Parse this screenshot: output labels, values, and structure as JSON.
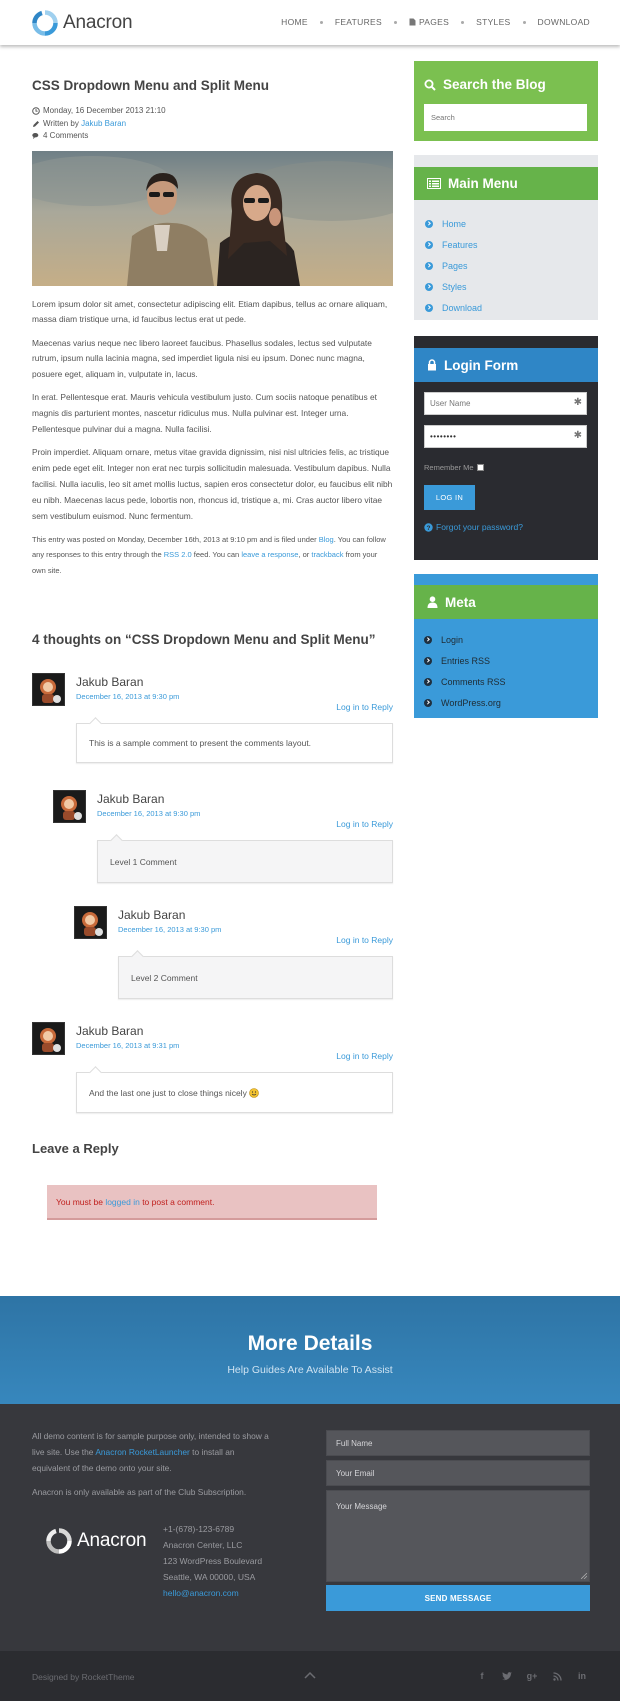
{
  "header": {
    "brand": "Anacron",
    "nav": [
      "HOME",
      "FEATURES",
      "PAGES",
      "STYLES",
      "DOWNLOAD"
    ]
  },
  "post": {
    "title": "CSS Dropdown Menu and Split Menu",
    "date": "Monday, 16 December 2013 21:10",
    "written_by_label": "Written by",
    "author": "Jakub Baran",
    "comments_count": "4 Comments",
    "paragraphs": [
      "Lorem ipsum dolor sit amet, consectetur adipiscing elit. Etiam dapibus, tellus ac ornare aliquam, massa diam tristique urna, id faucibus lectus erat ut pede.",
      "Maecenas varius neque nec libero laoreet faucibus. Phasellus sodales, lectus sed vulputate rutrum, ipsum nulla lacinia magna, sed imperdiet ligula nisi eu ipsum. Donec nunc magna, posuere eget, aliquam in, vulputate in, lacus.",
      "In erat. Pellentesque erat. Mauris vehicula vestibulum justo. Cum sociis natoque penatibus et magnis dis parturient montes, nascetur ridiculus mus. Nulla pulvinar est. Integer urna. Pellentesque pulvinar dui a magna. Nulla facilisi.",
      "Proin imperdiet. Aliquam ornare, metus vitae gravida dignissim, nisi nisl ultricies felis, ac tristique enim pede eget elit. Integer non erat nec turpis sollicitudin malesuada. Vestibulum dapibus. Nulla facilisi. Nulla iaculis, leo sit amet mollis luctus, sapien eros consectetur dolor, eu faucibus elit nibh eu nibh. Maecenas lacus pede, lobortis non, rhoncus id, tristique a, mi. Cras auctor libero vitae sem vestibulum euismod. Nunc fermentum."
    ],
    "footnote": {
      "p1": "This entry was posted on Monday, December 16th, 2013 at 9:10 pm and is filed under ",
      "category": "Blog",
      "p2": ". You can follow any responses to this entry through the ",
      "rss": "RSS 2.0",
      "p3": " feed. You can ",
      "leave": "leave a response",
      "p4": ", or ",
      "trackback": "trackback",
      "p5": " from your own site."
    }
  },
  "comments": {
    "title": "4 thoughts on “CSS Dropdown Menu and Split Menu”",
    "reply_label": "Log in to Reply",
    "items": [
      {
        "author": "Jakub Baran",
        "date": "December 16, 2013 at 9:30 pm",
        "text": "This is a sample comment to present the comments layout."
      },
      {
        "author": "Jakub Baran",
        "date": "December 16, 2013 at 9:30 pm",
        "text": "Level 1 Comment"
      },
      {
        "author": "Jakub Baran",
        "date": "December 16, 2013 at 9:30 pm",
        "text": "Level 2 Comment"
      },
      {
        "author": "Jakub Baran",
        "date": "December 16, 2013 at 9:31 pm",
        "text": "And the last one just to close things nicely"
      }
    ]
  },
  "reply": {
    "title": "Leave a Reply",
    "must_be": "You must be ",
    "logged_in": "logged in",
    "to_post": " to post a comment."
  },
  "sidebar": {
    "search": {
      "title": "Search the Blog",
      "placeholder": "Search"
    },
    "main_menu": {
      "title": "Main Menu",
      "items": [
        "Home",
        "Features",
        "Pages",
        "Styles",
        "Download"
      ]
    },
    "login": {
      "title": "Login Form",
      "username_placeholder": "User Name",
      "password_value": "••••••••",
      "remember": "Remember Me",
      "button": "LOG IN",
      "forgot": "Forgot your password?"
    },
    "meta": {
      "title": "Meta",
      "items": [
        "Login",
        "Entries RSS",
        "Comments RSS",
        "WordPress.org"
      ]
    }
  },
  "more_details": {
    "title": "More Details",
    "subtitle": "Help Guides Are Available To Assist"
  },
  "footer": {
    "text1a": "All demo content is for sample purpose only, intended to show a live site. Use the ",
    "text1_link": "Anacron RocketLauncher",
    "text1b": " to install an equivalent of the demo onto your site.",
    "text2": "Anacron is only available as part of the Club Subscription.",
    "brand": "Anacron",
    "phone": "+1-(678)-123-6789",
    "company": "Anacron Center, LLC",
    "street": "123 WordPress Boulevard",
    "city": "Seattle, WA 00000, USA",
    "email": "hello@anacron.com",
    "form": {
      "name": "Full Name",
      "email": "Your Email",
      "message": "Your Message",
      "send": "SEND MESSAGE"
    },
    "credit": "Designed by RocketTheme"
  },
  "colors": {
    "accent_blue": "#3a9ad9",
    "green": "#66b34a",
    "dark": "#2a2b30"
  }
}
